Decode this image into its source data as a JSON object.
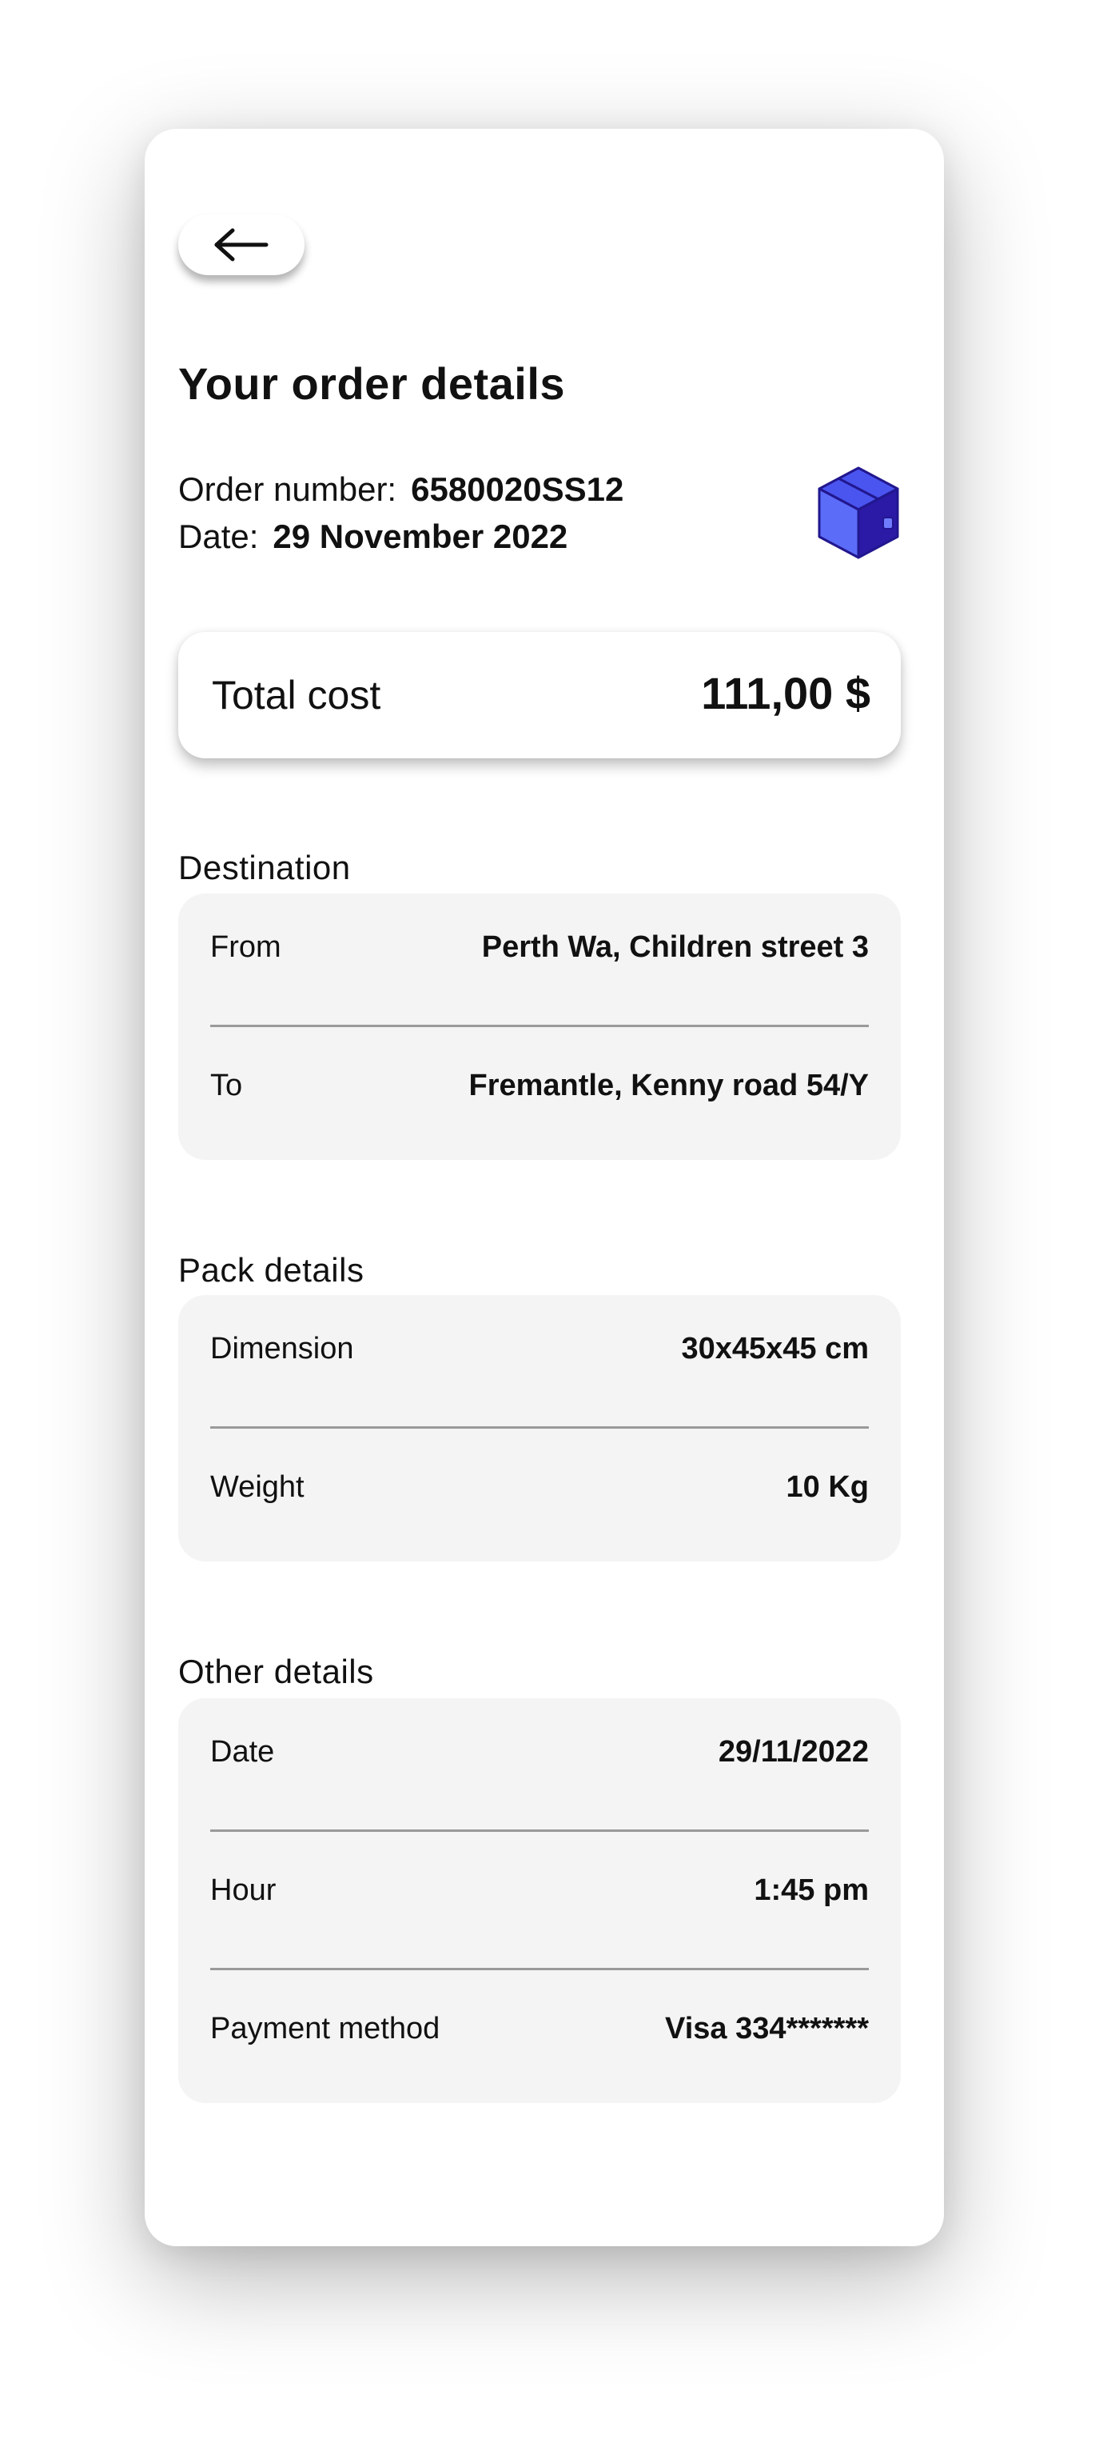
{
  "header": {
    "back_icon": "arrow-left-icon",
    "title": "Your order details"
  },
  "order": {
    "number_label": "Order number:",
    "number_value": "6580020SS12",
    "date_label": "Date:",
    "date_value": "29 November 2022",
    "package_icon": "package-box-icon"
  },
  "total": {
    "label": "Total cost",
    "value": "111,00 $"
  },
  "destination": {
    "title": "Destination",
    "rows": [
      {
        "label": "From",
        "value": "Perth Wa, Children street 3"
      },
      {
        "label": "To",
        "value": "Fremantle, Kenny road 54/Y"
      }
    ]
  },
  "pack": {
    "title": "Pack details",
    "rows": [
      {
        "label": "Dimension",
        "value": "30x45x45 cm"
      },
      {
        "label": "Weight",
        "value": "10 Kg"
      }
    ]
  },
  "other": {
    "title": "Other details",
    "rows": [
      {
        "label": "Date",
        "value": "29/11/2022"
      },
      {
        "label": "Hour",
        "value": "1:45 pm"
      },
      {
        "label": "Payment method",
        "value": "Visa 334*******"
      }
    ]
  },
  "colors": {
    "package_light": "#5b6cf8",
    "package_mid": "#3f43e6",
    "package_dark": "#2a1aa6",
    "panel_bg": "#f4f4f4"
  }
}
